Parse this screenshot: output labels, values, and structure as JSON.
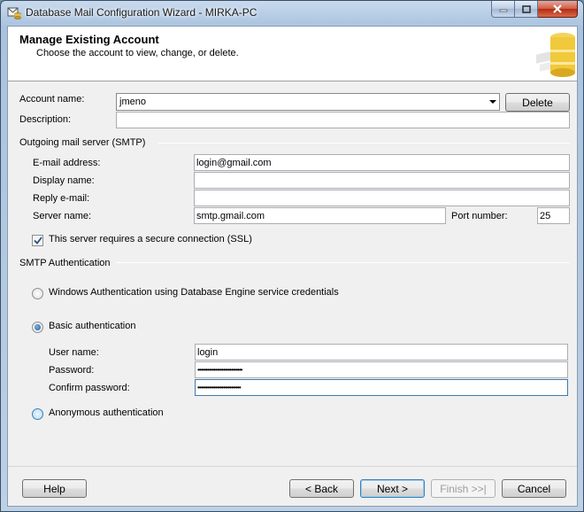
{
  "window": {
    "title": "Database Mail Configuration Wizard - MIRKA-PC"
  },
  "header": {
    "title": "Manage Existing Account",
    "subtitle": "Choose the account to view, change, or delete."
  },
  "account": {
    "name_label": "Account name:",
    "name_value": "jmeno",
    "delete_label": "Delete",
    "description_label": "Description:",
    "description_value": ""
  },
  "smtp": {
    "group_label": "Outgoing mail server (SMTP)",
    "email_label": "E-mail address:",
    "email_value": "login@gmail.com",
    "display_label": "Display name:",
    "display_value": "",
    "reply_label": "Reply e-mail:",
    "reply_value": "",
    "server_label": "Server name:",
    "server_value": "smtp.gmail.com",
    "port_label": "Port number:",
    "port_value": "25",
    "ssl_label": "This server requires a secure connection (SSL)",
    "ssl_checked": true
  },
  "auth": {
    "group_label": "SMTP Authentication",
    "windows_label": "Windows Authentication using Database Engine service credentials",
    "basic_label": "Basic authentication",
    "username_label": "User name:",
    "username_value": "login",
    "password_label": "Password:",
    "password_value": "••••••••••••••••••••••••••••",
    "confirm_label": "Confirm password:",
    "confirm_value": "•••••••••••••••••••••••••••",
    "anonymous_label": "Anonymous authentication",
    "selected": "basic"
  },
  "footer": {
    "help_label": "Help",
    "back_label": "< Back",
    "next_label": "Next >",
    "finish_label": "Finish >>|",
    "cancel_label": "Cancel"
  }
}
